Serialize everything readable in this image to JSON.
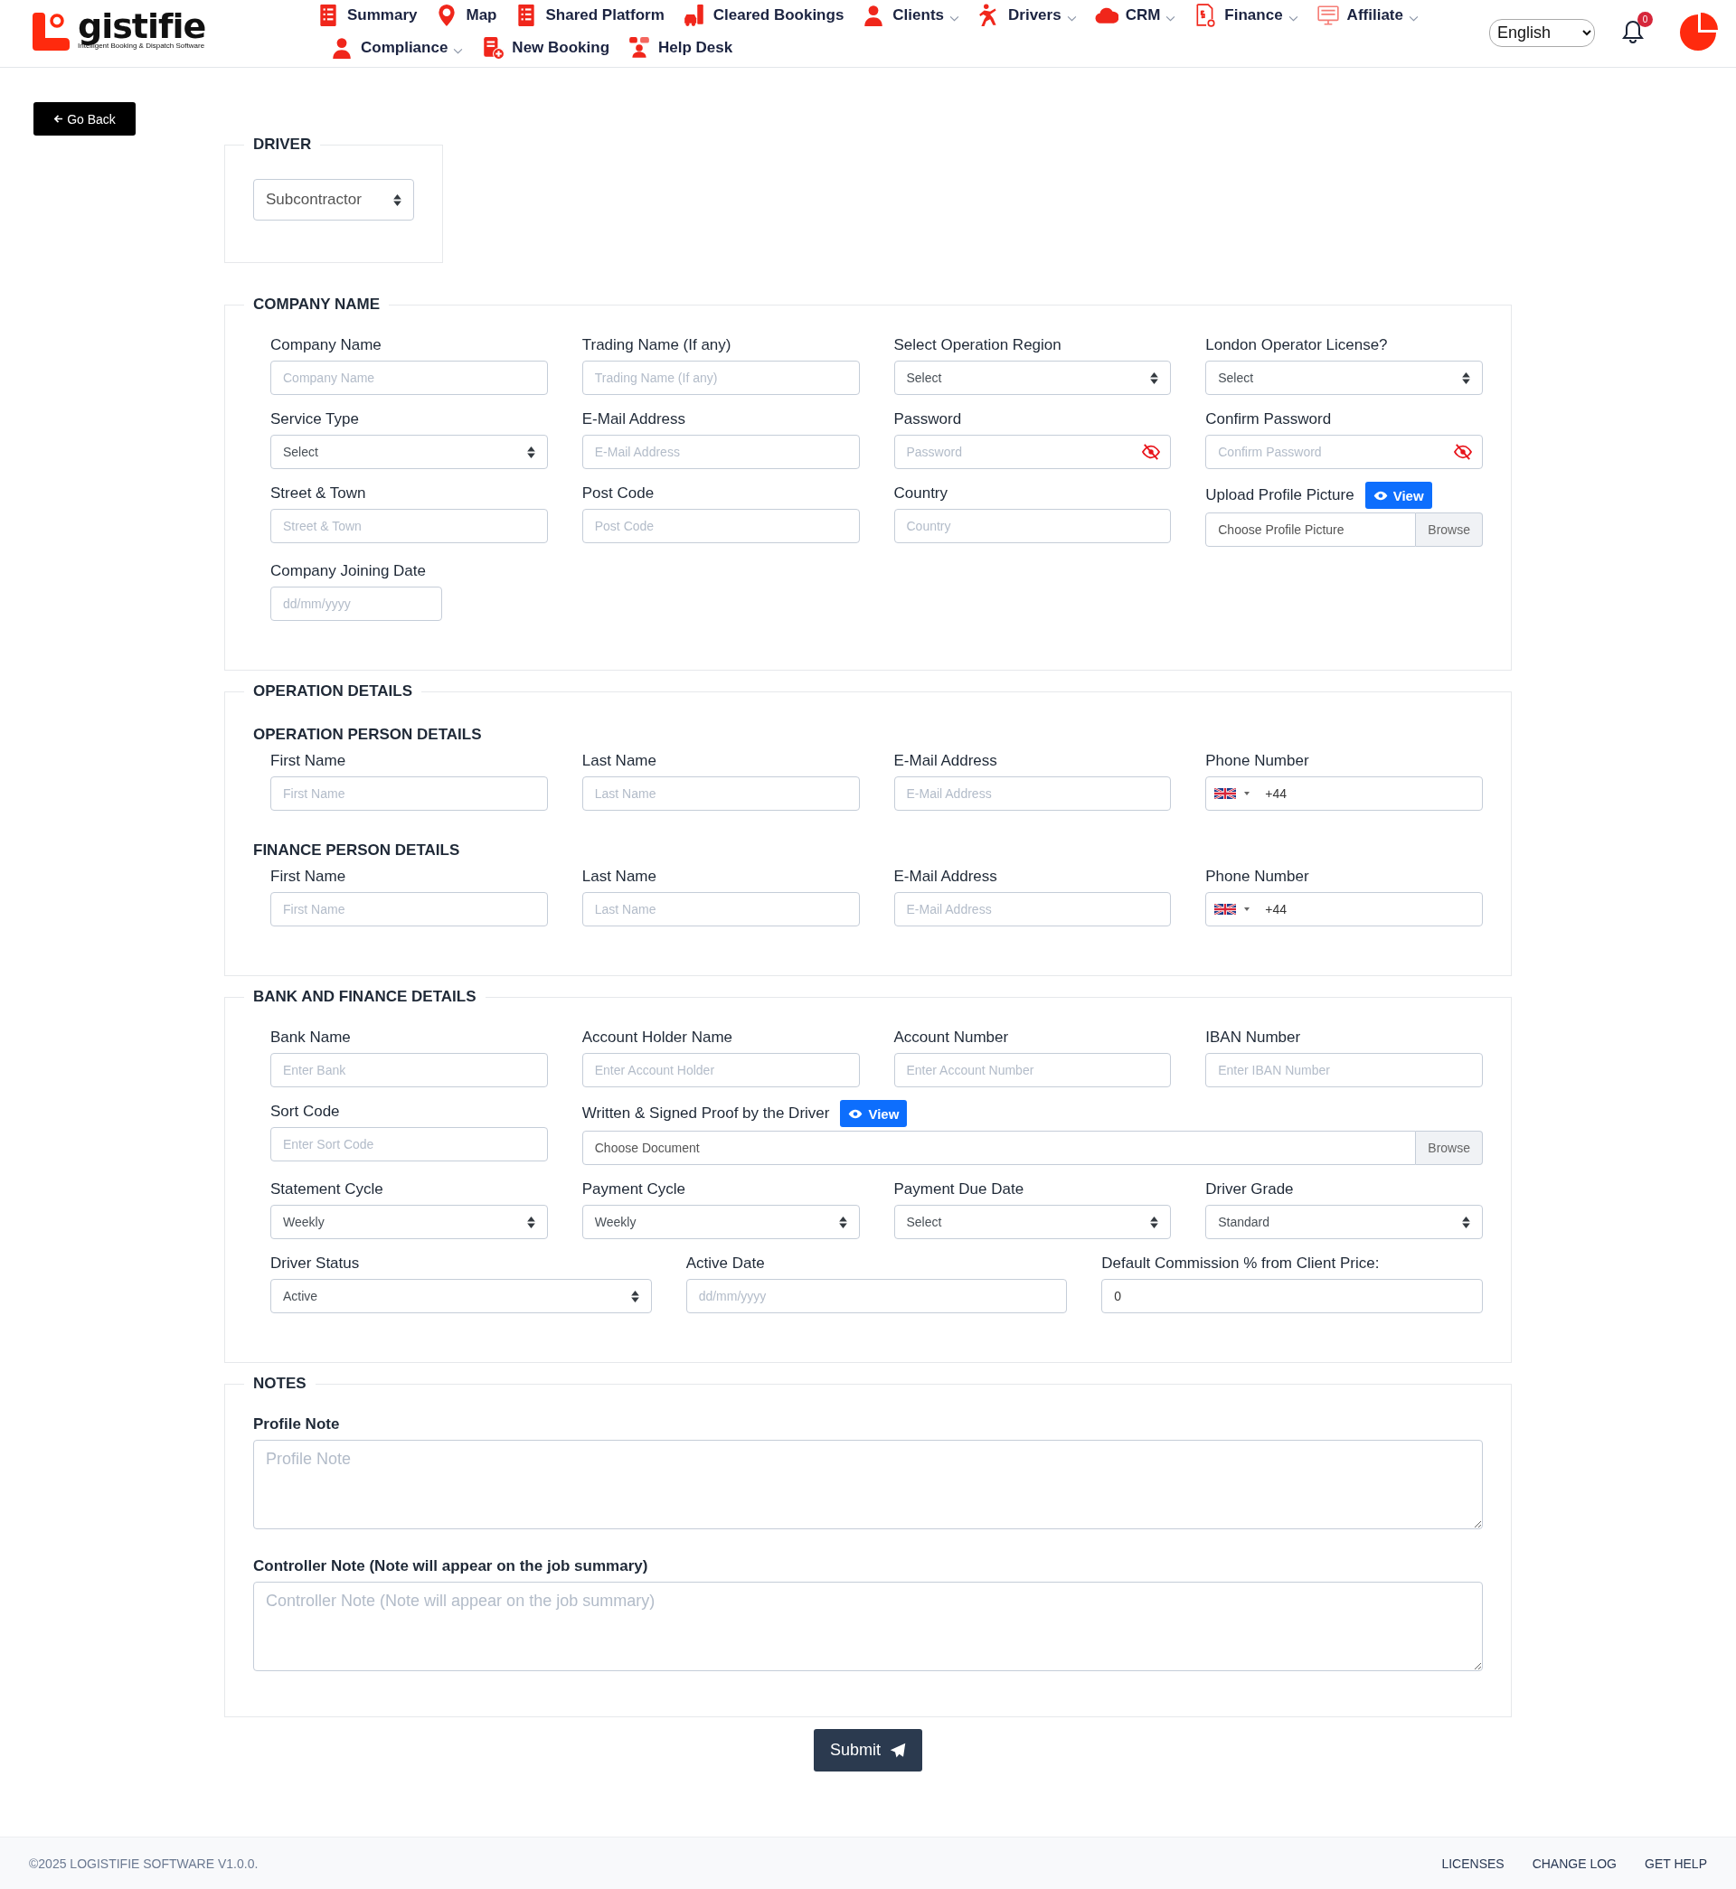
{
  "header": {
    "logo": {
      "word": "gistifie",
      "tagline": "Intelligent Booking & Dispatch Software"
    },
    "nav_rows": [
      [
        {
          "label": "Summary",
          "dropdown": false
        },
        {
          "label": "Map",
          "dropdown": false
        },
        {
          "label": "Shared Platform",
          "dropdown": false
        },
        {
          "label": "Cleared Bookings",
          "dropdown": false
        },
        {
          "label": "Clients",
          "dropdown": true
        },
        {
          "label": "Drivers",
          "dropdown": true
        },
        {
          "label": "CRM",
          "dropdown": true
        },
        {
          "label": "Finance",
          "dropdown": true
        },
        {
          "label": "Affiliate",
          "dropdown": true
        }
      ],
      [
        {
          "label": "Compliance",
          "dropdown": true
        },
        {
          "label": "New Booking",
          "dropdown": false
        },
        {
          "label": "Help Desk",
          "dropdown": false
        }
      ]
    ],
    "language": "English",
    "notifications": "0"
  },
  "back_button": "Go Back",
  "sections": [
    {
      "title": "DRIVER",
      "kind": "compact",
      "groups": [
        {
          "rows": [
            [
              {
                "kind": "select",
                "value": "Subcontractor"
              }
            ]
          ]
        }
      ]
    },
    {
      "title": "COMPANY NAME",
      "kind": "grid",
      "groups": [
        {
          "rows": [
            [
              {
                "label": "Company Name",
                "kind": "text",
                "placeholder": "Company Name"
              },
              {
                "label": "Trading Name (If any)",
                "kind": "text",
                "placeholder": "Trading Name (If any)"
              },
              {
                "label": "Select Operation Region",
                "kind": "select",
                "value": "Select"
              },
              {
                "label": "London Operator License?",
                "kind": "select",
                "value": "Select"
              }
            ],
            [
              {
                "label": "Service Type",
                "kind": "select",
                "value": "Select"
              },
              {
                "label": "E-Mail Address",
                "kind": "text",
                "placeholder": "E-Mail Address"
              },
              {
                "label": "Password",
                "kind": "password",
                "placeholder": "Password"
              },
              {
                "label": "Confirm Password",
                "kind": "password",
                "placeholder": "Confirm Password"
              }
            ],
            [
              {
                "label": "Street & Town",
                "kind": "text",
                "placeholder": "Street & Town"
              },
              {
                "label": "Post Code",
                "kind": "text",
                "placeholder": "Post Code"
              },
              {
                "label": "Country",
                "kind": "text",
                "placeholder": "Country"
              },
              {
                "label": "Upload Profile Picture",
                "kind": "file",
                "placeholder": "Choose Profile Picture",
                "button": "Browse",
                "action": "View"
              }
            ],
            [
              {
                "label": "Company Joining Date",
                "kind": "date",
                "placeholder": "dd/mm/yyyy"
              }
            ]
          ]
        }
      ]
    },
    {
      "title": "OPERATION DETAILS",
      "kind": "grid",
      "groups": [
        {
          "heading": "OPERATION PERSON DETAILS",
          "rows": [
            [
              {
                "label": "First Name",
                "kind": "text",
                "placeholder": "First Name"
              },
              {
                "label": "Last Name",
                "kind": "text",
                "placeholder": "Last Name"
              },
              {
                "label": "E-Mail Address",
                "kind": "text",
                "placeholder": "E-Mail Address"
              },
              {
                "label": "Phone Number",
                "kind": "phone",
                "value": "+44"
              }
            ]
          ]
        },
        {
          "heading": "FINANCE PERSON DETAILS",
          "rows": [
            [
              {
                "label": "First Name",
                "kind": "text",
                "placeholder": "First Name"
              },
              {
                "label": "Last Name",
                "kind": "text",
                "placeholder": "Last Name"
              },
              {
                "label": "E-Mail Address",
                "kind": "text",
                "placeholder": "E-Mail Address"
              },
              {
                "label": "Phone Number",
                "kind": "phone",
                "value": "+44"
              }
            ]
          ]
        }
      ]
    },
    {
      "title": "BANK AND FINANCE DETAILS",
      "kind": "grid",
      "groups": [
        {
          "rows": [
            [
              {
                "label": "Bank Name",
                "kind": "text",
                "placeholder": "Enter Bank"
              },
              {
                "label": "Account Holder Name",
                "kind": "text",
                "placeholder": "Enter Account Holder"
              },
              {
                "label": "Account Number",
                "kind": "text",
                "placeholder": "Enter Account Number"
              },
              {
                "label": "IBAN Number",
                "kind": "text",
                "placeholder": "Enter IBAN Number"
              }
            ],
            [
              {
                "label": "Sort Code",
                "kind": "text",
                "placeholder": "Enter Sort Code"
              },
              {
                "label": "Written & Signed Proof by the Driver",
                "kind": "file",
                "placeholder": "Choose Document",
                "button": "Browse",
                "action": "View"
              }
            ],
            [
              {
                "label": "Statement Cycle",
                "kind": "select",
                "value": "Weekly"
              },
              {
                "label": "Payment Cycle",
                "kind": "select",
                "value": "Weekly"
              },
              {
                "label": "Payment Due Date",
                "kind": "select",
                "value": "Select"
              },
              {
                "label": "Driver Grade",
                "kind": "select",
                "value": "Standard"
              }
            ]
          ]
        },
        {
          "rows": [
            [
              {
                "label": "Driver Status",
                "kind": "select",
                "value": "Active"
              },
              {
                "label": "Active Date",
                "kind": "date",
                "placeholder": "dd/mm/yyyy"
              },
              {
                "label": "Default Commission % from Client Price:",
                "kind": "text",
                "value": "0"
              }
            ]
          ]
        }
      ]
    },
    {
      "title": "NOTES",
      "kind": "notes",
      "groups": [
        {
          "rows": [
            [
              {
                "label": "Profile Note",
                "kind": "textarea",
                "placeholder": "Profile Note"
              }
            ],
            [
              {
                "label": "Controller Note (Note will appear on the job summary)",
                "kind": "textarea",
                "placeholder": "Controller Note (Note will appear on the job summary)"
              }
            ]
          ]
        }
      ]
    }
  ],
  "submit": "Submit",
  "footer": {
    "copyright": "©2025 LOGISTIFIE SOFTWARE V1.0.0.",
    "links": [
      "LICENSES",
      "CHANGE LOG",
      "GET HELP"
    ]
  }
}
